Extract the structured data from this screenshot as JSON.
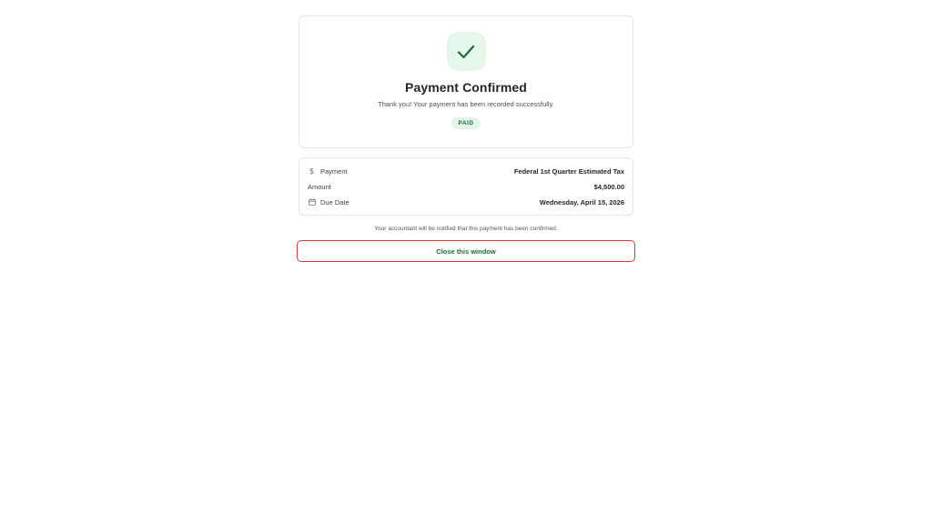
{
  "confirmation": {
    "title": "Payment Confirmed",
    "message": "Thank you! Your payment has been recorded successfully.",
    "status_badge": "PAID"
  },
  "details": {
    "rows": [
      {
        "label": "Payment",
        "value": "Federal 1st Quarter Estimated Tax",
        "icon": "dollar-icon"
      },
      {
        "label": "Amount",
        "value": "$4,500.00",
        "icon": ""
      },
      {
        "label": "Due Date",
        "value": "Wednesday, April 15, 2026",
        "icon": "calendar-icon"
      }
    ]
  },
  "note": "Your accountant will be notified that this payment has been confirmed.",
  "actions": {
    "close_label": "Close this window"
  },
  "colors": {
    "accent_green": "#1e6b3c",
    "badge_bg": "#e5f6ea",
    "focus_outline": "#d63a3a"
  }
}
